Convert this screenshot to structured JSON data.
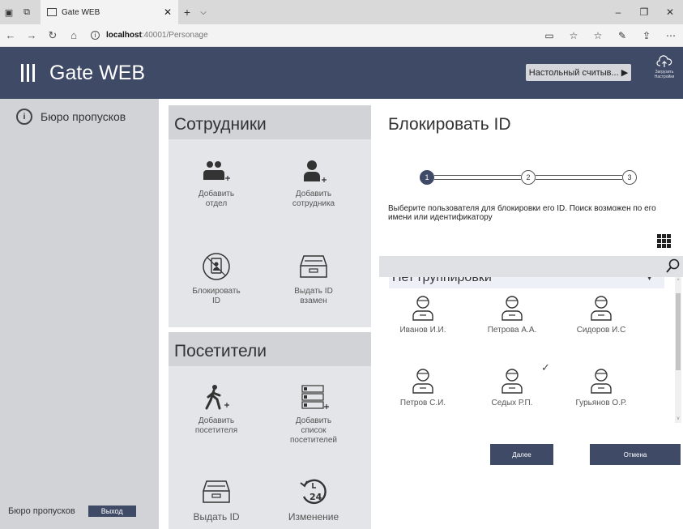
{
  "browser": {
    "tab_title": "Gate WEB",
    "url_host": "localhost",
    "url_path": ":40001/Personage"
  },
  "app": {
    "title": "Gate WEB",
    "reader_label": "Настольный считыв... ▶",
    "upload_line1": "Загрузить",
    "upload_line2": "Настройки"
  },
  "sidebar": {
    "item_label": "Бюро пропусков",
    "footer_label": "Бюро пропусков",
    "logout_label": "Выход"
  },
  "employees": {
    "title": "Сотрудники",
    "tiles": [
      {
        "line1": "Добавить",
        "line2": "отдел"
      },
      {
        "line1": "Добавить",
        "line2": "сотрудника"
      },
      {
        "line1": "Блокировать",
        "line2": "ID"
      },
      {
        "line1": "Выдать ID",
        "line2": "взамен"
      }
    ]
  },
  "visitors": {
    "title": "Посетители",
    "tiles": [
      {
        "line1": "Добавить",
        "line2": "посетителя",
        "line3": ""
      },
      {
        "line1": "Добавить",
        "line2": "список",
        "line3": "посетителей"
      },
      {
        "line1": "Выдать ID",
        "line2": "",
        "line3": ""
      },
      {
        "line1": "Изменение",
        "line2": "",
        "line3": ""
      }
    ]
  },
  "dialog": {
    "title": "Блокировать ID",
    "steps": [
      "1",
      "2",
      "3"
    ],
    "active_step": 1,
    "description": "Выберите пользователя для блокировки его ID. Поиск возможен по его имени или идентификатору",
    "grouping": "Нет группировки",
    "users": [
      {
        "name": "Иванов И.И.",
        "selected": false
      },
      {
        "name": "Петрова А.А.",
        "selected": false
      },
      {
        "name": "Сидоров И.С",
        "selected": false
      },
      {
        "name": "Петров С.И.",
        "selected": false
      },
      {
        "name": "Седых Р.П.",
        "selected": true
      },
      {
        "name": "Гурьянов О.Р.",
        "selected": false
      }
    ],
    "next_label": "Далее",
    "cancel_label": "Отмена"
  },
  "colors": {
    "primary": "#3e4a66",
    "panel_gray": "#d2d3d7",
    "tile_bg": "#e4e5e8"
  }
}
